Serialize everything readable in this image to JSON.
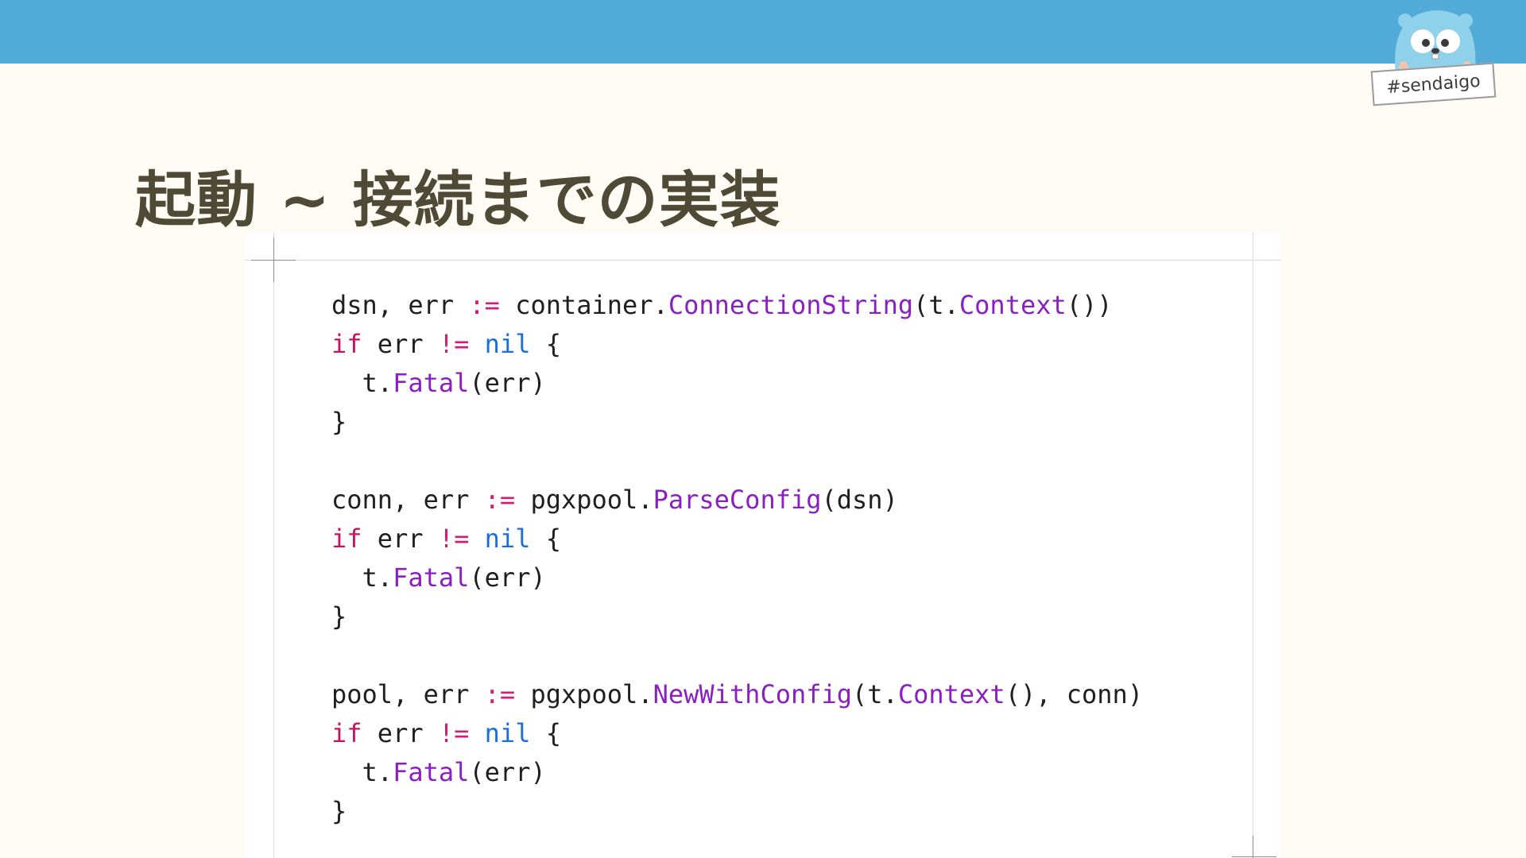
{
  "header": {
    "hashtag": "#sendaigo"
  },
  "slide": {
    "title": "起動 ~ 接続までの実装"
  },
  "code": {
    "lines": [
      [
        {
          "t": "dsn, err ",
          "c": ""
        },
        {
          "t": ":=",
          "c": "op"
        },
        {
          "t": " container.",
          "c": ""
        },
        {
          "t": "ConnectionString",
          "c": "fn"
        },
        {
          "t": "(t.",
          "c": ""
        },
        {
          "t": "Context",
          "c": "fn"
        },
        {
          "t": "())",
          "c": ""
        }
      ],
      [
        {
          "t": "if",
          "c": "kw"
        },
        {
          "t": " err ",
          "c": ""
        },
        {
          "t": "!=",
          "c": "op"
        },
        {
          "t": " ",
          "c": ""
        },
        {
          "t": "nil",
          "c": "nil"
        },
        {
          "t": " {",
          "c": ""
        }
      ],
      [
        {
          "t": "  t.",
          "c": ""
        },
        {
          "t": "Fatal",
          "c": "fn"
        },
        {
          "t": "(err)",
          "c": ""
        }
      ],
      [
        {
          "t": "}",
          "c": ""
        }
      ],
      [],
      [
        {
          "t": "conn, err ",
          "c": ""
        },
        {
          "t": ":=",
          "c": "op"
        },
        {
          "t": " pgxpool.",
          "c": ""
        },
        {
          "t": "ParseConfig",
          "c": "fn"
        },
        {
          "t": "(dsn)",
          "c": ""
        }
      ],
      [
        {
          "t": "if",
          "c": "kw"
        },
        {
          "t": " err ",
          "c": ""
        },
        {
          "t": "!=",
          "c": "op"
        },
        {
          "t": " ",
          "c": ""
        },
        {
          "t": "nil",
          "c": "nil"
        },
        {
          "t": " {",
          "c": ""
        }
      ],
      [
        {
          "t": "  t.",
          "c": ""
        },
        {
          "t": "Fatal",
          "c": "fn"
        },
        {
          "t": "(err)",
          "c": ""
        }
      ],
      [
        {
          "t": "}",
          "c": ""
        }
      ],
      [],
      [
        {
          "t": "pool, err ",
          "c": ""
        },
        {
          "t": ":=",
          "c": "op"
        },
        {
          "t": " pgxpool.",
          "c": ""
        },
        {
          "t": "NewWithConfig",
          "c": "fn"
        },
        {
          "t": "(t.",
          "c": ""
        },
        {
          "t": "Context",
          "c": "fn"
        },
        {
          "t": "(), conn)",
          "c": ""
        }
      ],
      [
        {
          "t": "if",
          "c": "kw"
        },
        {
          "t": " err ",
          "c": ""
        },
        {
          "t": "!=",
          "c": "op"
        },
        {
          "t": " ",
          "c": ""
        },
        {
          "t": "nil",
          "c": "nil"
        },
        {
          "t": " {",
          "c": ""
        }
      ],
      [
        {
          "t": "  t.",
          "c": ""
        },
        {
          "t": "Fatal",
          "c": "fn"
        },
        {
          "t": "(err)",
          "c": ""
        }
      ],
      [
        {
          "t": "}",
          "c": ""
        }
      ]
    ]
  },
  "colors": {
    "header_bar": "#52abd6",
    "background": "#fefcf4",
    "title": "#4f4a36",
    "keyword": "#c4155e",
    "operator": "#d11d74",
    "nil": "#1c6fd8",
    "function": "#8a1fc2"
  },
  "icons": {
    "mascot": "gopher-mascot-icon"
  }
}
